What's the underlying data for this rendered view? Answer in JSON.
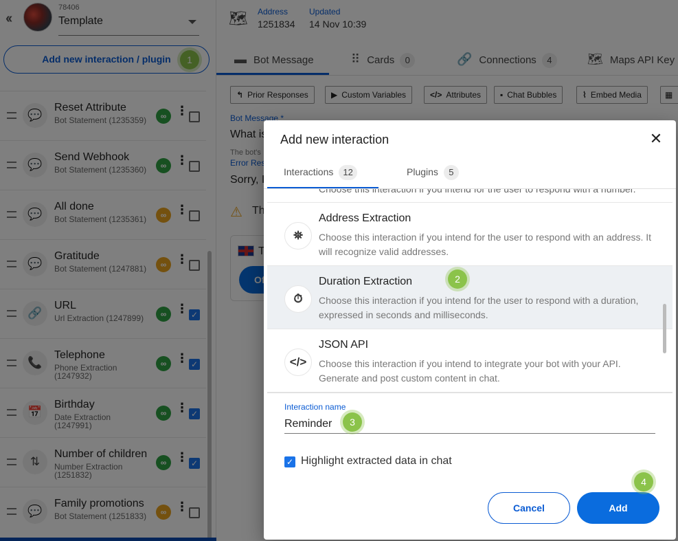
{
  "sidebar": {
    "collapse_icon": "double-chevron-left-icon",
    "bot_id": "78406",
    "bot_name": "Template",
    "add_button_label": "Add new interaction / plugin",
    "interactions": [
      {
        "title": "Reset Attribute",
        "subtitle": "Bot Statement (1235359)",
        "icon": "chat-bubble-icon",
        "glyph": "💬",
        "link_color": "#2ea043",
        "checked": false
      },
      {
        "title": "Send Webhook",
        "subtitle": "Bot Statement (1235360)",
        "icon": "chat-bubble-icon",
        "glyph": "💬",
        "link_color": "#2ea043",
        "checked": false
      },
      {
        "title": "All done",
        "subtitle": "Bot Statement (1235361)",
        "icon": "chat-bubble-icon",
        "glyph": "💬",
        "link_color": "#e9a21f",
        "checked": false
      },
      {
        "title": "Gratitude",
        "subtitle": "Bot Statement (1247881)",
        "icon": "chat-bubble-icon",
        "glyph": "💬",
        "link_color": "#e9a21f",
        "checked": false
      },
      {
        "title": "URL",
        "subtitle": "Url Extraction (1247899)",
        "icon": "link-icon",
        "glyph": "🔗",
        "link_color": "#2ea043",
        "checked": true
      },
      {
        "title": "Telephone",
        "subtitle": "Phone Extraction (1247932)",
        "icon": "phone-icon",
        "glyph": "📞",
        "link_color": "#2ea043",
        "checked": true
      },
      {
        "title": "Birthday",
        "subtitle": "Date Extraction (1247991)",
        "icon": "calendar-icon",
        "glyph": "📅",
        "link_color": "#2ea043",
        "checked": true
      },
      {
        "title": "Number of children",
        "subtitle": "Number Extraction (1251832)",
        "icon": "number-sort-icon",
        "glyph": "⇅",
        "link_color": "#2ea043",
        "checked": true
      },
      {
        "title": "Family promotions",
        "subtitle": "Bot Statement (1251833)",
        "icon": "chat-bubble-icon",
        "glyph": "💬",
        "link_color": "#e9a21f",
        "checked": false
      }
    ]
  },
  "main": {
    "header": {
      "address_label": "Address",
      "address_value": "1251834",
      "updated_label": "Updated",
      "updated_value": "14 Nov 10:39"
    },
    "tabs": [
      {
        "label": "Bot Message",
        "count": null,
        "icon": "message-icon"
      },
      {
        "label": "Cards",
        "count": "0",
        "icon": "grid-icon"
      },
      {
        "label": "Connections",
        "count": "4",
        "icon": "link-icon"
      },
      {
        "label": "Maps API Key",
        "count": null,
        "icon": "map-icon"
      }
    ],
    "toolbar": [
      {
        "label": "Prior Responses",
        "icon": "reply-icon"
      },
      {
        "label": "Custom Variables",
        "icon": "play-box-icon"
      },
      {
        "label": "Attributes",
        "icon": "code-icon"
      },
      {
        "label": "Chat Bubbles",
        "icon": "chat-icon"
      },
      {
        "label": "Embed Media",
        "icon": "paperclip-icon"
      }
    ],
    "bot_message_label": "Bot Message *",
    "bot_message_value": "What is",
    "bot_message_help": "The bot's",
    "error_label": "Error Res",
    "error_value": "Sorry, I",
    "warning_text": "Th",
    "preview_text": "T",
    "preview_button": "Of"
  },
  "dialog": {
    "title": "Add new interaction",
    "tabs": [
      {
        "label": "Interactions",
        "count": "12"
      },
      {
        "label": "Plugins",
        "count": "5"
      }
    ],
    "cut_text": "Choose this interaction if you intend for the user to respond with a number.",
    "options": [
      {
        "title": "Address Extraction",
        "desc": "Choose this interaction if you intend for the user to respond with an address. It will recognize valid addresses.",
        "icon": "map-pin-icon",
        "glyph": "⛯"
      },
      {
        "title": "Duration Extraction",
        "desc": "Choose this interaction if you intend for the user to respond with a duration, expressed in seconds and milliseconds.",
        "icon": "stopwatch-icon",
        "glyph": "⏱"
      },
      {
        "title": "JSON API",
        "desc": "Choose this interaction if you intend to integrate your bot with your API. Generate and post custom content in chat.",
        "icon": "code-icon",
        "glyph": "</>"
      }
    ],
    "name_label": "Interaction name",
    "name_value": "Reminder",
    "highlight_label": "Highlight extracted data in chat",
    "highlight_checked": true,
    "cancel_label": "Cancel",
    "add_label": "Add"
  },
  "steps": [
    "1",
    "2",
    "3",
    "4"
  ],
  "colors": {
    "accent": "#0a5bd3",
    "primary_button": "#0a6cde",
    "step_badge": "#8bc34a",
    "link_ok": "#2ea043",
    "link_warn": "#e9a21f"
  }
}
